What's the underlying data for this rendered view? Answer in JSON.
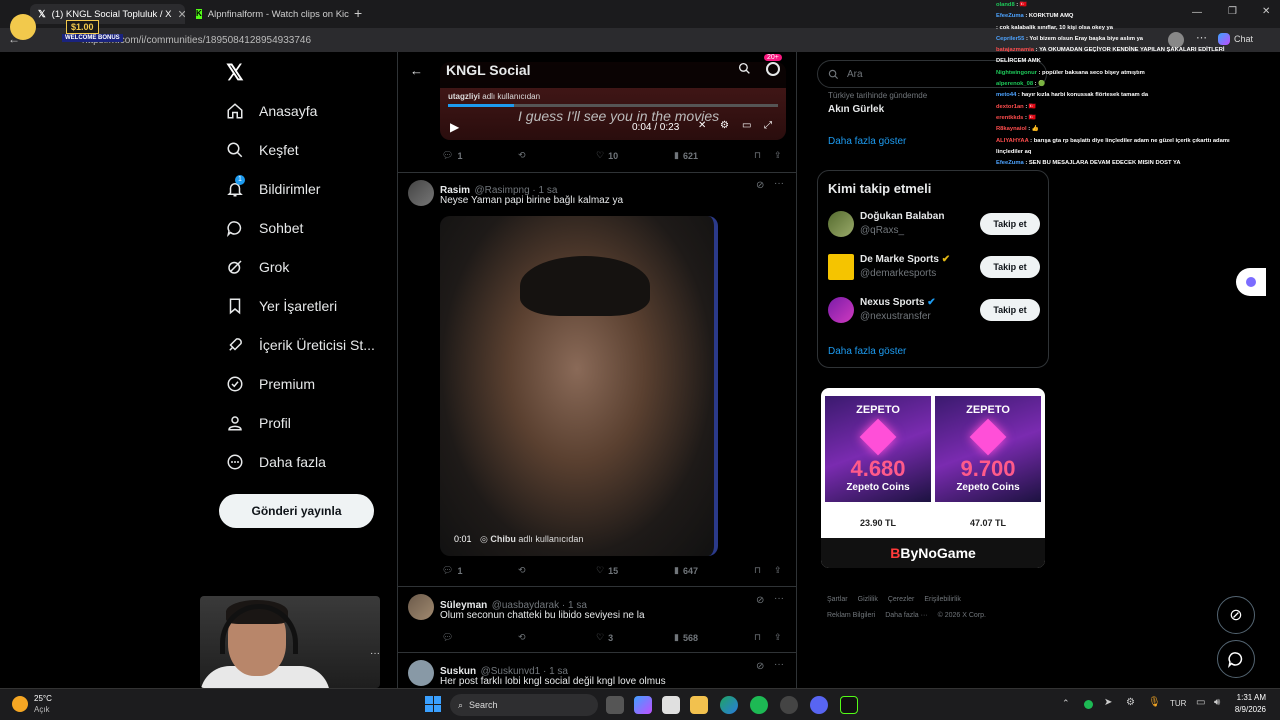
{
  "browser": {
    "tabs": [
      {
        "label": "(1) KNGL Social Topluluk / X"
      },
      {
        "label": "Alpnfinalform - Watch clips on Kic"
      }
    ],
    "url": "https://x.com/i/communities/1895084128954933746",
    "chat_label": "Chat"
  },
  "alert": {
    "amount": "$1.00",
    "text": "WELCOME BONUS"
  },
  "nav": {
    "items": [
      {
        "label": "Anasayfa",
        "icon": "home-icon"
      },
      {
        "label": "Keşfet",
        "icon": "search-icon"
      },
      {
        "label": "Bildirimler",
        "icon": "bell-icon",
        "badge": "1"
      },
      {
        "label": "Sohbet",
        "icon": "chat-bubble-icon"
      },
      {
        "label": "Grok",
        "icon": "grok-icon"
      },
      {
        "label": "Yer İşaretleri",
        "icon": "bookmark-icon"
      },
      {
        "label": "İçerik Üreticisi St...",
        "icon": "rocket-icon"
      },
      {
        "label": "Premium",
        "icon": "verified-icon"
      },
      {
        "label": "Profil",
        "icon": "person-icon"
      },
      {
        "label": "Daha fazla",
        "icon": "more-circle-icon"
      }
    ],
    "post_button": "Gönderi yayınla"
  },
  "column": {
    "title": "KNGL Social",
    "badge": "20+",
    "video1": {
      "caption_user": "utagzliyi",
      "caption_suffix": "adlı kullanıcıdan",
      "subtitle": "I guess I'll see you in the movies",
      "time": "0:04 / 0:23",
      "stats": {
        "replies": "1",
        "likes": "10",
        "views": "621"
      }
    },
    "tweets": [
      {
        "name": "Rasim",
        "handle": "@Rasimpng · 1 sa",
        "text": "Neyse Yaman papi birine bağlı kalmaz ya",
        "video_time": "0:01",
        "video_user": "Chibu",
        "video_suffix": "adlı kullanıcıdan",
        "stats": {
          "replies": "1",
          "likes": "15",
          "views": "647"
        }
      },
      {
        "name": "Süleyman",
        "handle": "@uasbaydarak · 1 sa",
        "text": "Olum seconun chatteki bu libido seviyesi ne la",
        "stats": {
          "replies": "",
          "likes": "3",
          "views": "568"
        }
      },
      {
        "name": "Suskun",
        "handle": "@Suskunvd1 · 1 sa",
        "text": "Her post farklı lobi kngl social değil kngl love olmus"
      }
    ]
  },
  "right": {
    "search_placeholder": "Ara",
    "trend_meta": "Türkiye tarihinde gündemde",
    "trend_name": "Akın Gürlek",
    "show_more": "Daha fazla göster",
    "who_to_follow_title": "Kimi takip etmeli",
    "suggestions": [
      {
        "name": "Doğukan Balaban",
        "handle": "@qRaxs_",
        "button": "Takip et",
        "verified": false
      },
      {
        "name": "De Marke Sports",
        "handle": "@demarkesports",
        "button": "Takip et",
        "verified": true
      },
      {
        "name": "Nexus Sports",
        "handle": "@nexustransfer",
        "button": "Takip et",
        "verified": true
      }
    ],
    "show_more_2": "Daha fazla göster",
    "ad": {
      "brand": "ZEPETO",
      "items": [
        {
          "amount": "4.680",
          "unit": "Zepeto Coins",
          "price": "23.90 TL"
        },
        {
          "amount": "9.700",
          "unit": "Zepeto Coins",
          "price": "47.07 TL"
        }
      ],
      "logo": "ByNoGame"
    },
    "footer": [
      "Şartlar",
      "Gizlilik",
      "Çerezler",
      "Erişilebilirlik",
      "Reklam Bilgileri",
      "Daha fazla ···",
      "© 2026 X Corp."
    ]
  },
  "chat": [
    {
      "user": "oland8",
      "msg": "🇹🇷",
      "color": "green"
    },
    {
      "user": "EfeeZuma",
      "msg": "KORKTUM AMQ",
      "color": "blue"
    },
    {
      "user": "",
      "msg": "cok kalabalik sınıflar, 10 kişi olsa okey ya",
      "color": "red"
    },
    {
      "user": "Cepriler55",
      "msg": "Yol bizem olsun Eray başka biye aslım ya",
      "color": "blue"
    },
    {
      "user": "batajazmamia",
      "msg": "YA OKUMADAN GEÇİYOR KENDİNE YAPILAN ŞAKALARI EDİTLERİ DELİRCEM AMK",
      "color": "red"
    },
    {
      "user": "Nightwingonur",
      "msg": "popüler baksana seco bişey atmıştım",
      "color": "green"
    },
    {
      "user": "alperenok_08",
      "msg": "🟢",
      "color": "green"
    },
    {
      "user": "meto44",
      "msg": "hayır kızla harbi konussak flörtesek tamam da",
      "color": "blue"
    },
    {
      "user": "dextor1an",
      "msg": "🇹🇷",
      "color": "red"
    },
    {
      "user": "erentkkds",
      "msg": "🇹🇷",
      "color": "red"
    },
    {
      "user": "R8kaynaiol",
      "msg": "👍",
      "color": "red"
    },
    {
      "user": "ALIYAHYAA",
      "msg": "barışa gta rp başlattı diye linçlediler adam ne güzel içerik çıkarttı adamı linçlediler aq",
      "color": "red"
    },
    {
      "user": "EfeeZuma",
      "msg": "SEN BU MESAJLARA DEVAM EDECEK MISIN DOST YA",
      "color": "blue"
    }
  ],
  "taskbar": {
    "weather_temp": "25°C",
    "weather_text": "Açık",
    "search_label": "Search",
    "language": "TUR",
    "time": "1:31 AM",
    "date": "8/9/2026"
  },
  "colors": {
    "accent": "#1d9bf0",
    "background": "#000000",
    "text": "#e7e9ea",
    "muted": "#71767b",
    "badge": "#f91880"
  }
}
